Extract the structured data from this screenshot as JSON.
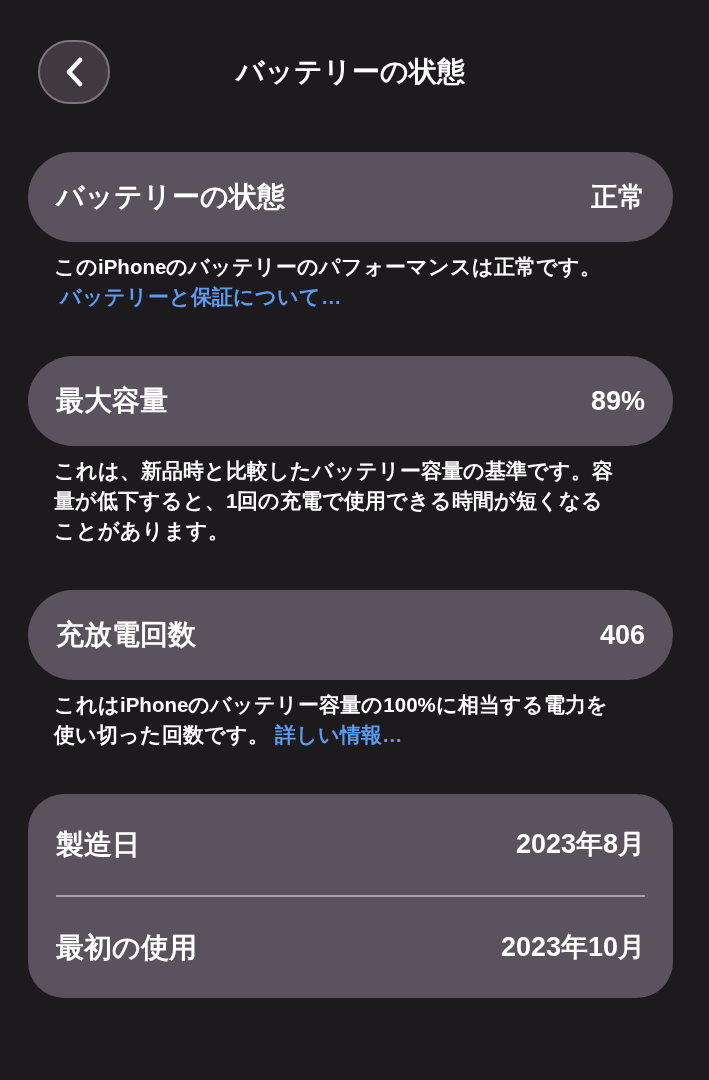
{
  "nav": {
    "title": "バッテリーの状態"
  },
  "sections": [
    {
      "rows": [
        {
          "label": "バッテリーの状態",
          "value": "正常"
        }
      ],
      "footer": {
        "text": "このiPhoneのバッテリーのパフォーマンスは正常です。",
        "link": "バッテリーと保証について…"
      }
    },
    {
      "rows": [
        {
          "label": "最大容量",
          "value": "89%"
        }
      ],
      "footer": {
        "text": "これは、新品時と比較したバッテリー容量の基準です。容量が低下すると、1回の充電で使用できる時間が短くなることがあります。"
      }
    },
    {
      "rows": [
        {
          "label": "充放電回数",
          "value": "406"
        }
      ],
      "footer": {
        "text": "これはiPhoneのバッテリー容量の100%に相当する電力を使い切った回数です。",
        "link": "詳しい情報…"
      }
    },
    {
      "rows": [
        {
          "label": "製造日",
          "value": "2023年8月"
        },
        {
          "label": "最初の使用",
          "value": "2023年10月"
        }
      ]
    }
  ]
}
